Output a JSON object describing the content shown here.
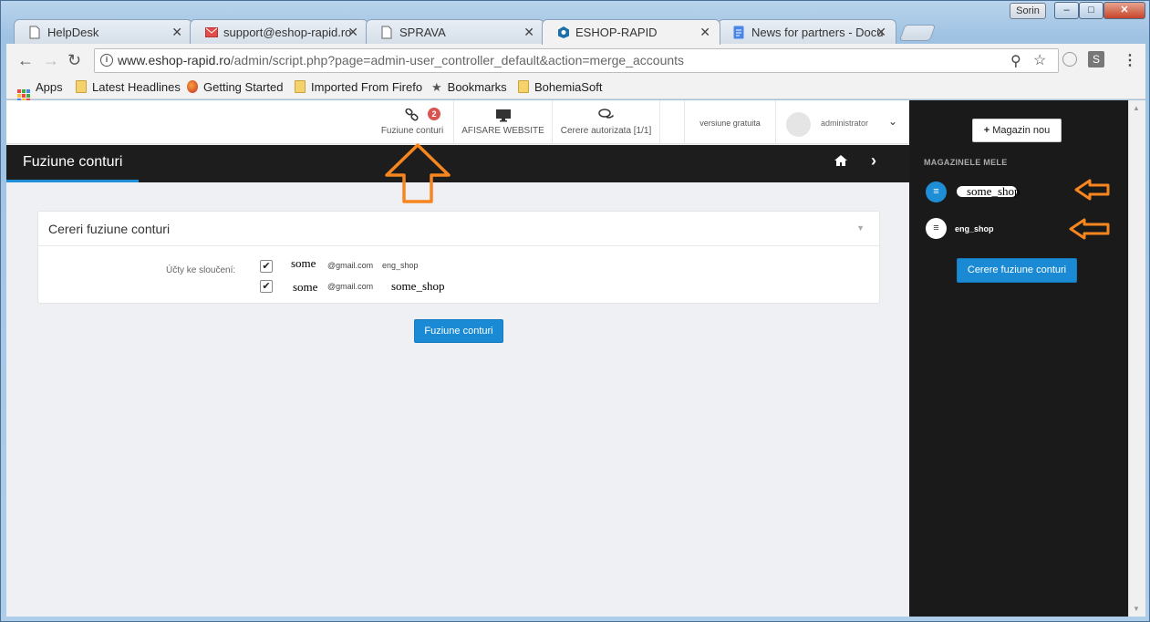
{
  "window": {
    "user": "Sorin",
    "min": "–",
    "max": "□",
    "close": "✕"
  },
  "tabs": [
    {
      "label": "HelpDesk",
      "icon": "page-icon"
    },
    {
      "label": "support@eshop-rapid.ro",
      "icon": "mail-icon"
    },
    {
      "label": "SPRAVA",
      "icon": "page-icon"
    },
    {
      "label": "ESHOP-RAPID",
      "icon": "hexagon-icon"
    },
    {
      "label": "News for partners - Docu",
      "icon": "docs-icon"
    }
  ],
  "url": {
    "host": "www.eshop-rapid.ro",
    "path": "/admin/script.php?page=admin-user_controller_default&action=merge_accounts"
  },
  "bookmarks": [
    "Apps",
    "Latest Headlines",
    "Getting Started",
    "Imported From Firefo",
    "Bookmarks",
    "BohemiaSoft"
  ],
  "topbar": {
    "merge_label": "Fuziune conturi",
    "merge_badge": "2",
    "website_label": "AFISARE WEBSITE",
    "requests_label": "Cerere autorizata [1/1]",
    "version_label": "versiune gratuita",
    "user_label": "administrator"
  },
  "page": {
    "title": "Fuziune conturi",
    "panel_title": "Cereri fuziune conturi",
    "accounts_label": "Účty ke sloučení:",
    "accounts": [
      {
        "name": "some",
        "email": "@gmail.com",
        "shop": "eng_shop"
      },
      {
        "name": "some",
        "email": "@gmail.com",
        "shop": "some_shop"
      }
    ],
    "merge_button": "Fuziune conturi"
  },
  "sidebar": {
    "new_shop_button": "Magazin nou",
    "section_title": "MAGAZINELE MELE",
    "shops": [
      "some_shop",
      "eng_shop"
    ],
    "merge_request_button": "Cerere fuziune conturi"
  },
  "colors": {
    "accent": "#1a8ad4",
    "dark": "#1a1a1a",
    "annotation": "#f7861f",
    "badge": "#d9534f"
  }
}
